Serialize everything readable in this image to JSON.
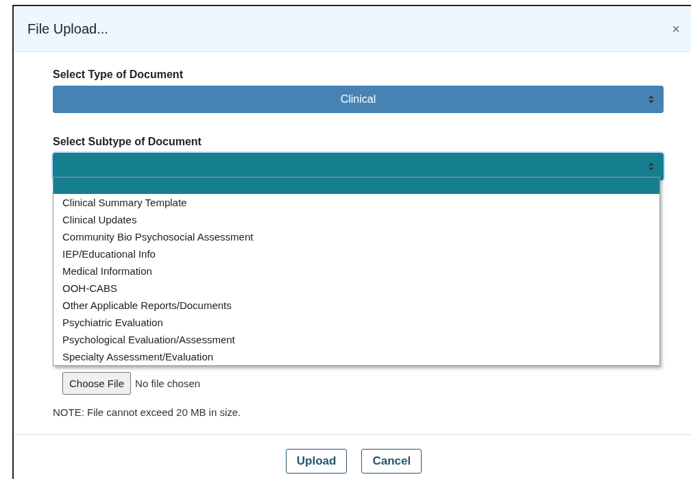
{
  "dialog": {
    "title": "File Upload...",
    "close": "×"
  },
  "type_field": {
    "label": "Select Type of Document",
    "value": "Clinical",
    "focused": false
  },
  "subtype_field": {
    "label": "Select Subtype of Document",
    "focused": true,
    "expanded": true,
    "blank_option_highlighted": true,
    "options": [
      {
        "label": "Clinical Summary Template",
        "selected": false
      },
      {
        "label": "Clinical Updates",
        "selected": false
      },
      {
        "label": "Community Bio Psychosocial Assessment",
        "selected": false
      },
      {
        "label": "IEP/Educational Info",
        "selected": false
      },
      {
        "label": "Medical Information",
        "selected": false
      },
      {
        "label": "OOH-CABS",
        "selected": false
      },
      {
        "label": "Other Applicable Reports/Documents",
        "selected": false
      },
      {
        "label": "Psychiatric Evaluation",
        "selected": false
      },
      {
        "label": "Psychological Evaluation/Assessment",
        "selected": false
      },
      {
        "label": "Specialty Assessment/Evaluation",
        "selected": false
      }
    ]
  },
  "file_input": {
    "button": "Choose File",
    "status": "No file chosen"
  },
  "note": "NOTE: File cannot exceed 20 MB in size.",
  "buttons": [
    "Upload",
    "Cancel"
  ]
}
